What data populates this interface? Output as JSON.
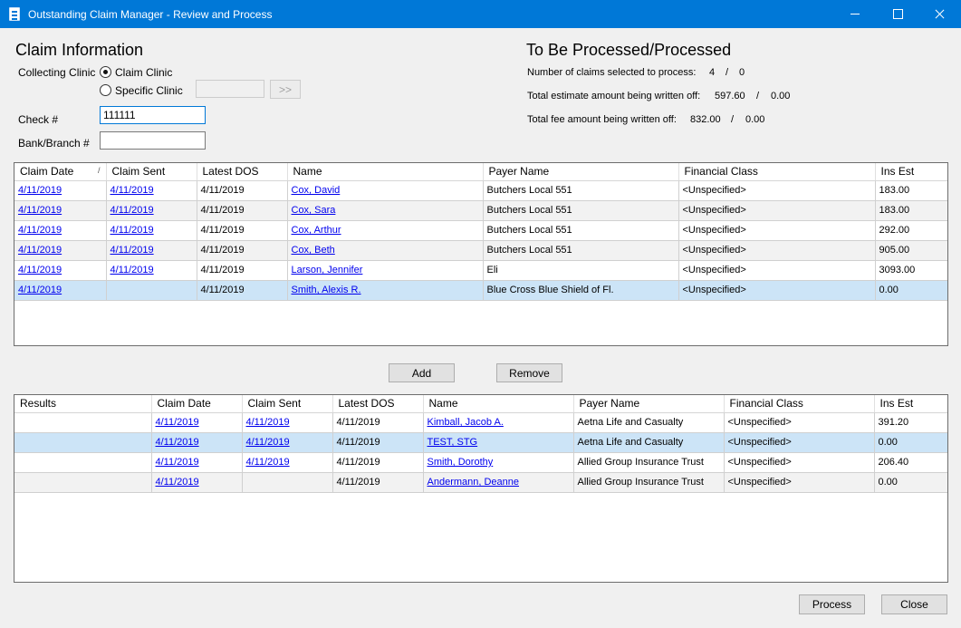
{
  "window": {
    "title": "Outstanding Claim Manager - Review and Process"
  },
  "claim_info": {
    "heading": "Claim Information",
    "collecting_clinic_label": "Collecting Clinic",
    "option_claim_clinic": "Claim Clinic",
    "option_specific_clinic": "Specific Clinic",
    "specific_clinic_value": "",
    "browse_label": ">>",
    "check_label": "Check #",
    "check_value": "111111",
    "bank_label": "Bank/Branch #",
    "bank_value": ""
  },
  "process_summary": {
    "heading": "To Be Processed/Processed",
    "claims_label": "Number of claims selected to process:",
    "claims_selected": "4",
    "claims_processed": "0",
    "estimate_label": "Total estimate amount being written off:",
    "estimate_selected": "597.60",
    "estimate_processed": "0.00",
    "fee_label": "Total fee amount being written off:",
    "fee_selected": "832.00",
    "fee_processed": "0.00",
    "separator": "/"
  },
  "top_grid": {
    "columns": [
      "Claim Date",
      "Claim Sent",
      "Latest DOS",
      "Name",
      "Payer Name",
      "Financial Class",
      "Ins Est"
    ],
    "sort_glyph": "/",
    "rows": [
      [
        "4/11/2019",
        "4/11/2019",
        "4/11/2019",
        "Cox, David",
        "Butchers Local  551",
        "<Unspecified>",
        "183.00"
      ],
      [
        "4/11/2019",
        "4/11/2019",
        "4/11/2019",
        "Cox, Sara",
        "Butchers Local  551",
        "<Unspecified>",
        "183.00"
      ],
      [
        "4/11/2019",
        "4/11/2019",
        "4/11/2019",
        "Cox, Arthur",
        "Butchers Local  551",
        "<Unspecified>",
        "292.00"
      ],
      [
        "4/11/2019",
        "4/11/2019",
        "4/11/2019",
        "Cox, Beth",
        "Butchers Local  551",
        "<Unspecified>",
        "905.00"
      ],
      [
        "4/11/2019",
        "4/11/2019",
        "4/11/2019",
        "Larson, Jennifer",
        "Eli",
        "<Unspecified>",
        "3093.00"
      ],
      [
        "4/11/2019",
        "",
        "4/11/2019",
        "Smith, Alexis R.",
        "Blue Cross Blue Shield of Fl.",
        "<Unspecified>",
        "0.00"
      ]
    ]
  },
  "actions": {
    "add_label": "Add",
    "remove_label": "Remove"
  },
  "bottom_grid": {
    "columns": [
      "Results",
      "Claim Date",
      "Claim Sent",
      "Latest DOS",
      "Name",
      "Payer Name",
      "Financial Class",
      "Ins Est"
    ],
    "rows": [
      [
        "",
        "4/11/2019",
        "4/11/2019",
        "4/11/2019",
        "Kimball, Jacob A.",
        "Aetna Life and Casualty",
        "<Unspecified>",
        "391.20"
      ],
      [
        "",
        "4/11/2019",
        "4/11/2019",
        "4/11/2019",
        "TEST, STG",
        "Aetna Life and Casualty",
        "<Unspecified>",
        "0.00"
      ],
      [
        "",
        "4/11/2019",
        "4/11/2019",
        "4/11/2019",
        "Smith, Dorothy",
        "Allied Group Insurance Trust",
        "<Unspecified>",
        "206.40"
      ],
      [
        "",
        "4/11/2019",
        "",
        "4/11/2019",
        "Andermann, Deanne",
        "Allied Group Insurance Trust",
        "<Unspecified>",
        "0.00"
      ]
    ]
  },
  "footer": {
    "process_label": "Process",
    "close_label": "Close"
  }
}
